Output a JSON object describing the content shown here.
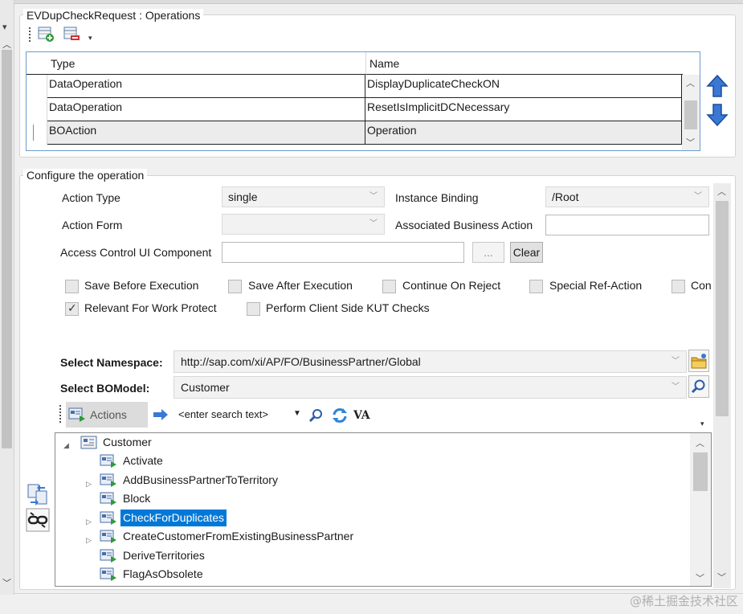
{
  "operations": {
    "group_title": "EVDupCheckRequest : Operations",
    "columns": [
      "Type",
      "Name"
    ],
    "rows": [
      {
        "type": "DataOperation",
        "name": "DisplayDuplicateCheckON"
      },
      {
        "type": "DataOperation",
        "name": "ResetIsImplicitDCNecessary"
      },
      {
        "type": "BOAction",
        "name": "Operation"
      }
    ]
  },
  "configure": {
    "group_title": "Configure the operation",
    "action_type_label": "Action Type",
    "action_type_value": "single",
    "instance_binding_label": "Instance Binding",
    "instance_binding_value": "/Root",
    "action_form_label": "Action Form",
    "action_form_value": "",
    "associated_ba_label": "Associated Business Action",
    "access_control_label": "Access Control UI Component",
    "browse_label": "...",
    "clear_label": "Clear",
    "checkboxes": [
      {
        "label": "Save Before Execution",
        "checked": false
      },
      {
        "label": "Save After Execution",
        "checked": false
      },
      {
        "label": "Continue On Reject",
        "checked": false
      },
      {
        "label": "Special Ref-Action",
        "checked": false
      },
      {
        "label": "Con",
        "checked": false
      },
      {
        "label": "Relevant For Work Protect",
        "checked": true
      },
      {
        "label": "Perform Client Side KUT Checks",
        "checked": false
      }
    ],
    "namespace_label": "Select Namespace:",
    "namespace_value": "http://sap.com/xi/AP/FO/BusinessPartner/Global",
    "bomodel_label": "Select BOModel:",
    "bomodel_value": "Customer"
  },
  "search_bar": {
    "actions_label": "Actions",
    "search_placeholder": "<enter search text>",
    "va_label": "VA"
  },
  "tree": {
    "root": "Customer",
    "items": [
      {
        "label": "Activate",
        "expandable": false,
        "selected": false
      },
      {
        "label": "AddBusinessPartnerToTerritory",
        "expandable": true,
        "selected": false
      },
      {
        "label": "Block",
        "expandable": false,
        "selected": false
      },
      {
        "label": "CheckForDuplicates",
        "expandable": true,
        "selected": true
      },
      {
        "label": "CreateCustomerFromExistingBusinessPartner",
        "expandable": true,
        "selected": false
      },
      {
        "label": "DeriveTerritories",
        "expandable": false,
        "selected": false
      },
      {
        "label": "FlagAsObsolete",
        "expandable": false,
        "selected": false
      }
    ]
  },
  "watermark": "@稀土掘金技术社区"
}
